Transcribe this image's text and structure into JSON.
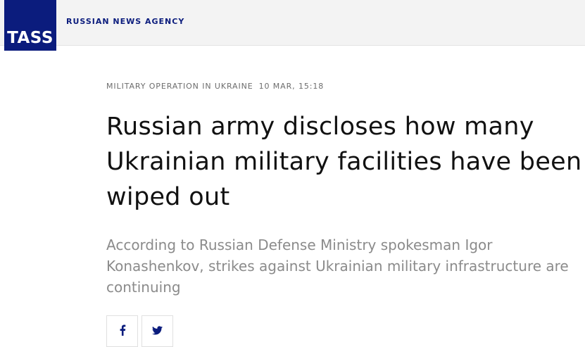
{
  "header": {
    "logo_text": "TASS",
    "agency_name": "RUSSIAN NEWS AGENCY"
  },
  "article": {
    "category": "MILITARY OPERATION IN UKRAINE",
    "timestamp": "10 MAR, 15:18",
    "title": "Russian army discloses how many Ukrainian military facilities have been wiped out",
    "lead": "According to Russian Defense Ministry spokesman Igor Konashenkov, strikes against Ukrainian military infrastructure are continuing"
  },
  "share": {
    "buttons": [
      {
        "icon": "facebook-icon"
      },
      {
        "icon": "twitter-icon"
      }
    ]
  },
  "colors": {
    "brand": "#0b1c7d",
    "meta_gray": "#6d6d6d",
    "lead_gray": "#8b8b8b",
    "header_bg": "#f3f3f3"
  }
}
